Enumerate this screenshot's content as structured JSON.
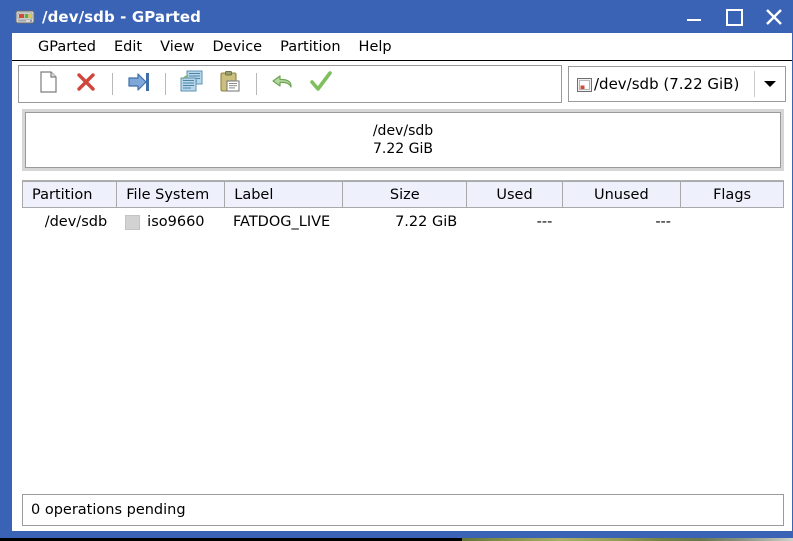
{
  "window": {
    "title": "/dev/sdb - GParted",
    "icon": "harddisk-icon",
    "minimize_label": "minimize-icon",
    "maximize_label": "maximize-icon",
    "close_label": "close-icon"
  },
  "menubar": {
    "items": [
      {
        "label": "GParted"
      },
      {
        "label": "Edit"
      },
      {
        "label": "View"
      },
      {
        "label": "Device"
      },
      {
        "label": "Partition"
      },
      {
        "label": "Help"
      }
    ]
  },
  "toolbar": {
    "buttons": [
      {
        "name": "new-partition-button",
        "icon": "new-document-icon"
      },
      {
        "name": "delete-partition-button",
        "icon": "delete-x-icon"
      },
      {
        "name": "resize-move-button",
        "icon": "resize-arrow-icon"
      },
      {
        "name": "copy-button",
        "icon": "copy-icon"
      },
      {
        "name": "paste-button",
        "icon": "paste-clipboard-icon"
      },
      {
        "name": "undo-button",
        "icon": "undo-arrow-icon"
      },
      {
        "name": "apply-button",
        "icon": "apply-check-icon"
      }
    ]
  },
  "device_selector": {
    "icon": "drive-icon",
    "value": "/dev/sdb (7.22 GiB)",
    "arrow": "chevron-down-icon"
  },
  "disk_graphic": {
    "device": "/dev/sdb",
    "size": "7.22 GiB",
    "fill_color": "#ffffff"
  },
  "table": {
    "columns": [
      {
        "key": "partition",
        "label": "Partition"
      },
      {
        "key": "filesystem",
        "label": "File System"
      },
      {
        "key": "label",
        "label": "Label"
      },
      {
        "key": "size",
        "label": "Size"
      },
      {
        "key": "used",
        "label": "Used"
      },
      {
        "key": "unused",
        "label": "Unused"
      },
      {
        "key": "flags",
        "label": "Flags"
      }
    ],
    "rows": [
      {
        "partition": "/dev/sdb",
        "fs_color": "#d2d2d2",
        "filesystem": "iso9660",
        "label": "FATDOG_LIVE",
        "size": "7.22 GiB",
        "used": "---",
        "unused": "---",
        "flags": ""
      }
    ]
  },
  "statusbar": {
    "text": "0 operations pending"
  },
  "colors": {
    "titlebar": "#3a63b5",
    "title_text": "#ffffff",
    "header_bg": "#eef1fb",
    "window_bg": "#ffffff",
    "iso9660_swatch": "#d2d2d2"
  }
}
